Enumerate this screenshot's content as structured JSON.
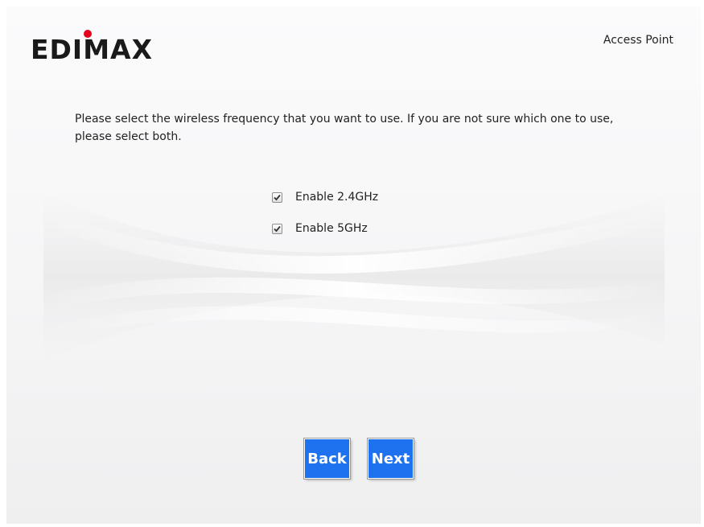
{
  "header": {
    "logo_text": "EDIMAX",
    "mode_label": "Access Point"
  },
  "main": {
    "instruction": "Please select the wireless frequency that you want to use. If you are not sure which one to use, please select both.",
    "options": [
      {
        "label": "Enable 2.4GHz",
        "checked": true
      },
      {
        "label": "Enable 5GHz",
        "checked": true
      }
    ]
  },
  "footer": {
    "back_label": "Back",
    "next_label": "Next"
  },
  "colors": {
    "button_bg": "#1f72ef",
    "logo_dot": "#e3001b",
    "logo_text": "#1a1a1a"
  },
  "icons": {
    "checkbox": "checkmark-icon"
  }
}
